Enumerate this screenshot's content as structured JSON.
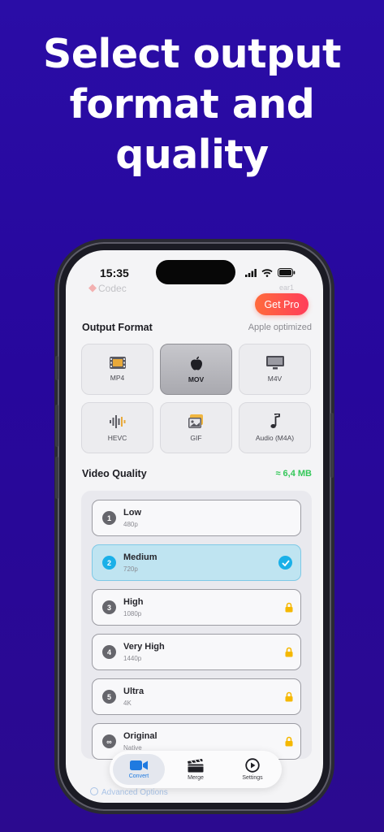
{
  "headline": {
    "line1": "Select output",
    "line2": "format and",
    "line3": "quality"
  },
  "status_bar": {
    "time": "15:35"
  },
  "background_header": {
    "left_label": "Codec",
    "right_label": "ear1"
  },
  "get_pro_label": "Get Pro",
  "output_format": {
    "title": "Output Format",
    "subtitle": "Apple optimized",
    "selected": "MOV",
    "formats": [
      {
        "label": "MP4",
        "icon": "film-icon"
      },
      {
        "label": "MOV",
        "icon": "apple-icon"
      },
      {
        "label": "M4V",
        "icon": "tv-icon"
      },
      {
        "label": "HEVC",
        "icon": "waveform-icon"
      },
      {
        "label": "GIF",
        "icon": "photo-icon"
      },
      {
        "label": "Audio (M4A)",
        "icon": "music-note-icon"
      }
    ]
  },
  "video_quality": {
    "title": "Video Quality",
    "estimated_size": "≈ 6,4 MB",
    "options": [
      {
        "num": "1",
        "name": "Low",
        "res": "480p",
        "state": "available"
      },
      {
        "num": "2",
        "name": "Medium",
        "res": "720p",
        "state": "selected"
      },
      {
        "num": "3",
        "name": "High",
        "res": "1080p",
        "state": "locked"
      },
      {
        "num": "4",
        "name": "Very High",
        "res": "1440p",
        "state": "locked"
      },
      {
        "num": "5",
        "name": "Ultra",
        "res": "4K",
        "state": "locked"
      },
      {
        "num": "∞",
        "name": "Original",
        "res": "Native",
        "state": "locked"
      }
    ]
  },
  "background_footer": {
    "label": "Advanced Options"
  },
  "tab_bar": {
    "active": "Convert",
    "tabs": [
      {
        "label": "Convert",
        "icon": "video-camera-icon"
      },
      {
        "label": "Merge",
        "icon": "clapperboard-icon"
      },
      {
        "label": "Settings",
        "icon": "play-circle-icon"
      }
    ]
  },
  "colors": {
    "background": "#2a0da6",
    "accent": "#1ab0e8",
    "pro_gradient_start": "#ff6b3c",
    "pro_gradient_end": "#ff3d5a",
    "size_text": "#34c759",
    "lock": "#f5b800"
  }
}
